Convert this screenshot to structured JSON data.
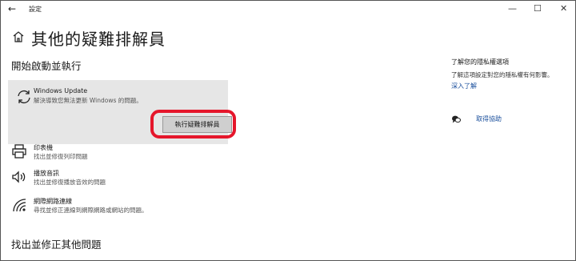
{
  "window": {
    "title": "設定",
    "back_icon": "←",
    "minimize_icon": "—",
    "maximize_icon": "☐",
    "close_icon": "✕"
  },
  "page": {
    "title": "其他的疑難排解員"
  },
  "sections": {
    "start": "開始啟動並執行",
    "other": "找出並修正其他問題"
  },
  "windows_update": {
    "name": "Windows Update",
    "description": "解決導致您無法更新 Windows 的問題。",
    "button": "執行疑難排解員"
  },
  "items": [
    {
      "icon": "printer-icon",
      "name": "印表機",
      "description": "找出並修復列印問題"
    },
    {
      "icon": "speaker-icon",
      "name": "播放音訊",
      "description": "找出並修復播放音效的問題"
    },
    {
      "icon": "wifi-icon",
      "name": "網際網路連線",
      "description": "尋找並修正連線到網際網路或網站的問題。"
    }
  ],
  "privacy": {
    "title": "了解您的隱私權選項",
    "description": "了解這項設定對您的隱私權有何影響。",
    "link": "深入了解"
  },
  "help": {
    "link": "取得協助"
  },
  "colors": {
    "highlight": "#e5162b",
    "link": "#1a4f9c",
    "card_bg": "#e6e6e6"
  }
}
